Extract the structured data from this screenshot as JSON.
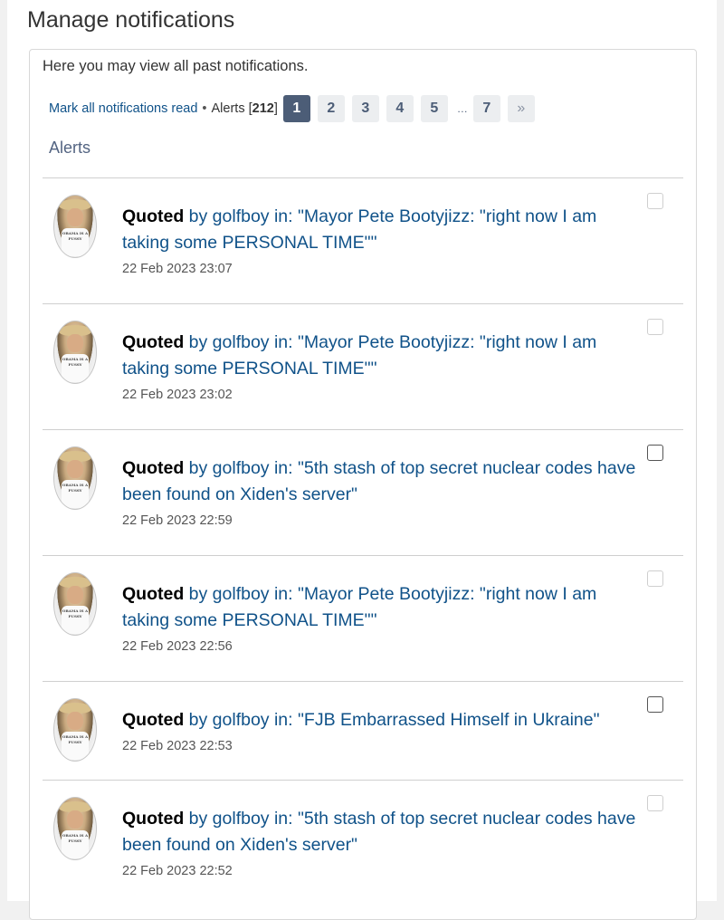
{
  "page": {
    "title": "Manage notifications",
    "intro": "Here you may view all past notifications."
  },
  "actions": {
    "mark_all_read": "Mark all notifications read",
    "separator": "•",
    "alerts_label": "Alerts [",
    "alerts_count": "212",
    "alerts_close": "]"
  },
  "pagination": {
    "pages": [
      "1",
      "2",
      "3",
      "4",
      "5"
    ],
    "ellipsis": "…",
    "last": "7",
    "next": "»",
    "current": "1"
  },
  "section_label": "Alerts",
  "notifications": [
    {
      "kind": "Quoted",
      "rest": " by golfboy in: \"Mayor Pete Bootyjizz: \"right now I am taking some PERSONAL TIME\"\"",
      "time": "22 Feb 2023 23:07",
      "checkbox_style": "light"
    },
    {
      "kind": "Quoted",
      "rest": " by golfboy in: \"Mayor Pete Bootyjizz: \"right now I am taking some PERSONAL TIME\"\"",
      "time": "22 Feb 2023 23:02",
      "checkbox_style": "light"
    },
    {
      "kind": "Quoted",
      "rest": " by golfboy in: \"5th stash of top secret nuclear codes have been found on Xiden's server\"",
      "time": "22 Feb 2023 22:59",
      "checkbox_style": "dark"
    },
    {
      "kind": "Quoted",
      "rest": " by golfboy in: \"Mayor Pete Bootyjizz: \"right now I am taking some PERSONAL TIME\"\"",
      "time": "22 Feb 2023 22:56",
      "checkbox_style": "light"
    },
    {
      "kind": "Quoted",
      "rest": " by golfboy in: \"FJB Embarrassed Himself in Ukraine\"",
      "time": "22 Feb 2023 22:53",
      "checkbox_style": "dark"
    },
    {
      "kind": "Quoted",
      "rest": " by golfboy in: \"5th stash of top secret nuclear codes have been found on Xiden's server\"",
      "time": "22 Feb 2023 22:52",
      "checkbox_style": "light"
    }
  ],
  "avatar_shirt_text": "OBAMA IS A PUSSY"
}
